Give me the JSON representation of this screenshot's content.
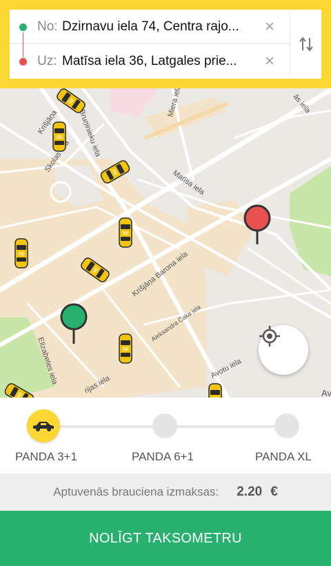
{
  "route": {
    "from_label": "No:",
    "from_value": "Dzirnavu iela 74, Centra rajo...",
    "to_label": "Uz:",
    "to_value": "Matīsa iela 36, Latgales prie..."
  },
  "map": {
    "streets": {
      "miera": "Miera iela",
      "brunieku": "Bruņinieku iela",
      "krisjana_top": "Krišjāņa",
      "skolas": "Skolas iela",
      "matisa": "Matīsa iela",
      "barona": "Krišjāņa Barona iela",
      "caka": "Aleksandra Čaka iela",
      "elizabetes": "Elizabetes iela",
      "marijas": "rijas iela",
      "avotu": "Avotu iela",
      "corner": "ās iela",
      "edge": "Av"
    }
  },
  "classes": [
    {
      "label": "PANDA 3+1",
      "selected": true
    },
    {
      "label": "PANDA 6+1",
      "selected": false
    },
    {
      "label": "PANDA XL",
      "selected": false
    }
  ],
  "price": {
    "label": "Aptuvenās brauciena izmaksas:",
    "value": "2.20",
    "currency": "€"
  },
  "order_button": "NOLĪGT TAKSOMETRU",
  "colors": {
    "accent": "#fdd835",
    "primary": "#27b06e",
    "destination": "#e8514f"
  },
  "icons": {
    "clear": "×",
    "swap": "swap-vertical-icon",
    "locate": "crosshair-icon",
    "car": "car-icon"
  }
}
